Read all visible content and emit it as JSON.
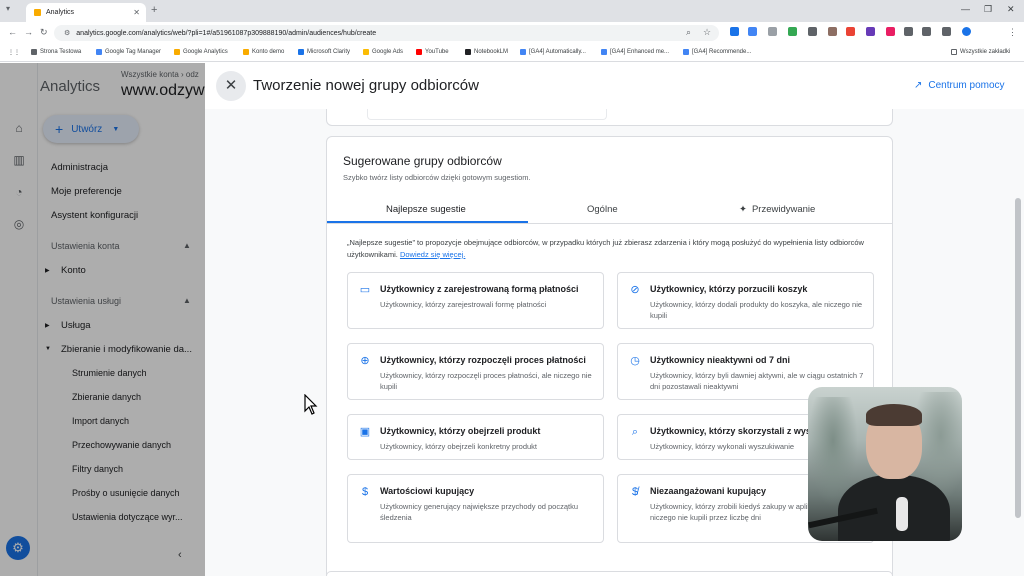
{
  "browser": {
    "tab_title": "Analytics",
    "url": "analytics.google.com/analytics/web/?pli=1#/a51961087p309888190/admin/audiences/hub/create",
    "bookmarks": [
      "Strona Testowa",
      "Google Tag Manager",
      "Google Analytics",
      "Konto demo",
      "Microsoft Clarity",
      "Google Ads",
      "YouTube",
      "NotebookLM",
      "[GA4] Automatically...",
      "[GA4] Enhanced me...",
      "[GA4] Recommende..."
    ],
    "all_bookmarks": "Wszystkie zakładki"
  },
  "ga": {
    "product": "Analytics",
    "account_path": "Wszystkie konta › odz",
    "account_name": "www.odzyw",
    "create_label": "Utwórz",
    "nav": {
      "admin": "Administracja",
      "prefs": "Moje preferencje",
      "setup": "Asystent konfiguracji",
      "account_settings": "Ustawienia konta",
      "account": "Konto",
      "property_settings": "Ustawienia usługi",
      "property": "Usługa",
      "data_collection": "Zbieranie i modyfikowanie da...",
      "subitems": [
        "Strumienie danych",
        "Zbieranie danych",
        "Import danych",
        "Przechowywanie danych",
        "Filtry danych",
        "Prośby o usunięcie danych",
        "Ustawienia dotyczące wyr..."
      ]
    }
  },
  "panel": {
    "title": "Tworzenie nowej grupy odbiorców",
    "help": "Centrum pomocy",
    "card_title": "Sugerowane grupy odbiorców",
    "card_subtitle": "Szybko twórz listy odbiorców dzięki gotowym sugestiom.",
    "tabs": [
      "Najlepsze sugestie",
      "Ogólne",
      "Przewidywanie"
    ],
    "active_tab": "Najlepsze sugestie",
    "description": "„Najlepsze sugestie” to propozycje obejmujące odbiorców, w przypadku których już zbierasz zdarzenia i który mogą posłużyć do wypełnienia listy odbiorców użytkownikami.",
    "learn_more": "Dowiedz się więcej.",
    "suggestions": [
      {
        "title": "Użytkownicy z zarejestrowaną formą płatności",
        "desc": "Użytkownicy, którzy zarejestrowali formę płatności",
        "icon": "credit-card-icon"
      },
      {
        "title": "Użytkownicy, którzy porzucili koszyk",
        "desc": "Użytkownicy, którzy dodali produkty do koszyka, ale niczego nie kupili",
        "icon": "remove-cart-icon"
      },
      {
        "title": "Użytkownicy, którzy rozpoczęli proces płatności",
        "desc": "Użytkownicy, którzy rozpoczęli proces płatności, ale niczego nie kupili",
        "icon": "cart-icon"
      },
      {
        "title": "Użytkownicy nieaktywni od 7 dni",
        "desc": "Użytkownicy, którzy byli dawniej aktywni, ale w ciągu ostatnich 7 dni pozostawali nieaktywni",
        "icon": "alarm-off-icon"
      },
      {
        "title": "Użytkownicy, którzy obejrzeli produkt",
        "desc": "Użytkownicy, którzy obejrzeli konkretny produkt",
        "icon": "product-view-icon"
      },
      {
        "title": "Użytkownicy, którzy skorzystali z wys",
        "desc": "Użytkownicy, którzy wykonali wyszukiwanie",
        "icon": "search-icon"
      },
      {
        "title": "Wartościowi kupujący",
        "desc": "Użytkownicy generujący największe przychody od początku śledzenia",
        "icon": "dollar-icon"
      },
      {
        "title": "Niezaangażowani kupujący",
        "desc": "Użytkownicy, którzy zrobili kiedyś zakupy w aplikacji, ale później niczego nie kupili przez liczbę dni",
        "icon": "money-off-icon"
      }
    ]
  },
  "colors": {
    "accent": "#1a73e8",
    "ga_orange": "#f9ab00",
    "scrim": "rgba(0,0,0,0.32)"
  }
}
